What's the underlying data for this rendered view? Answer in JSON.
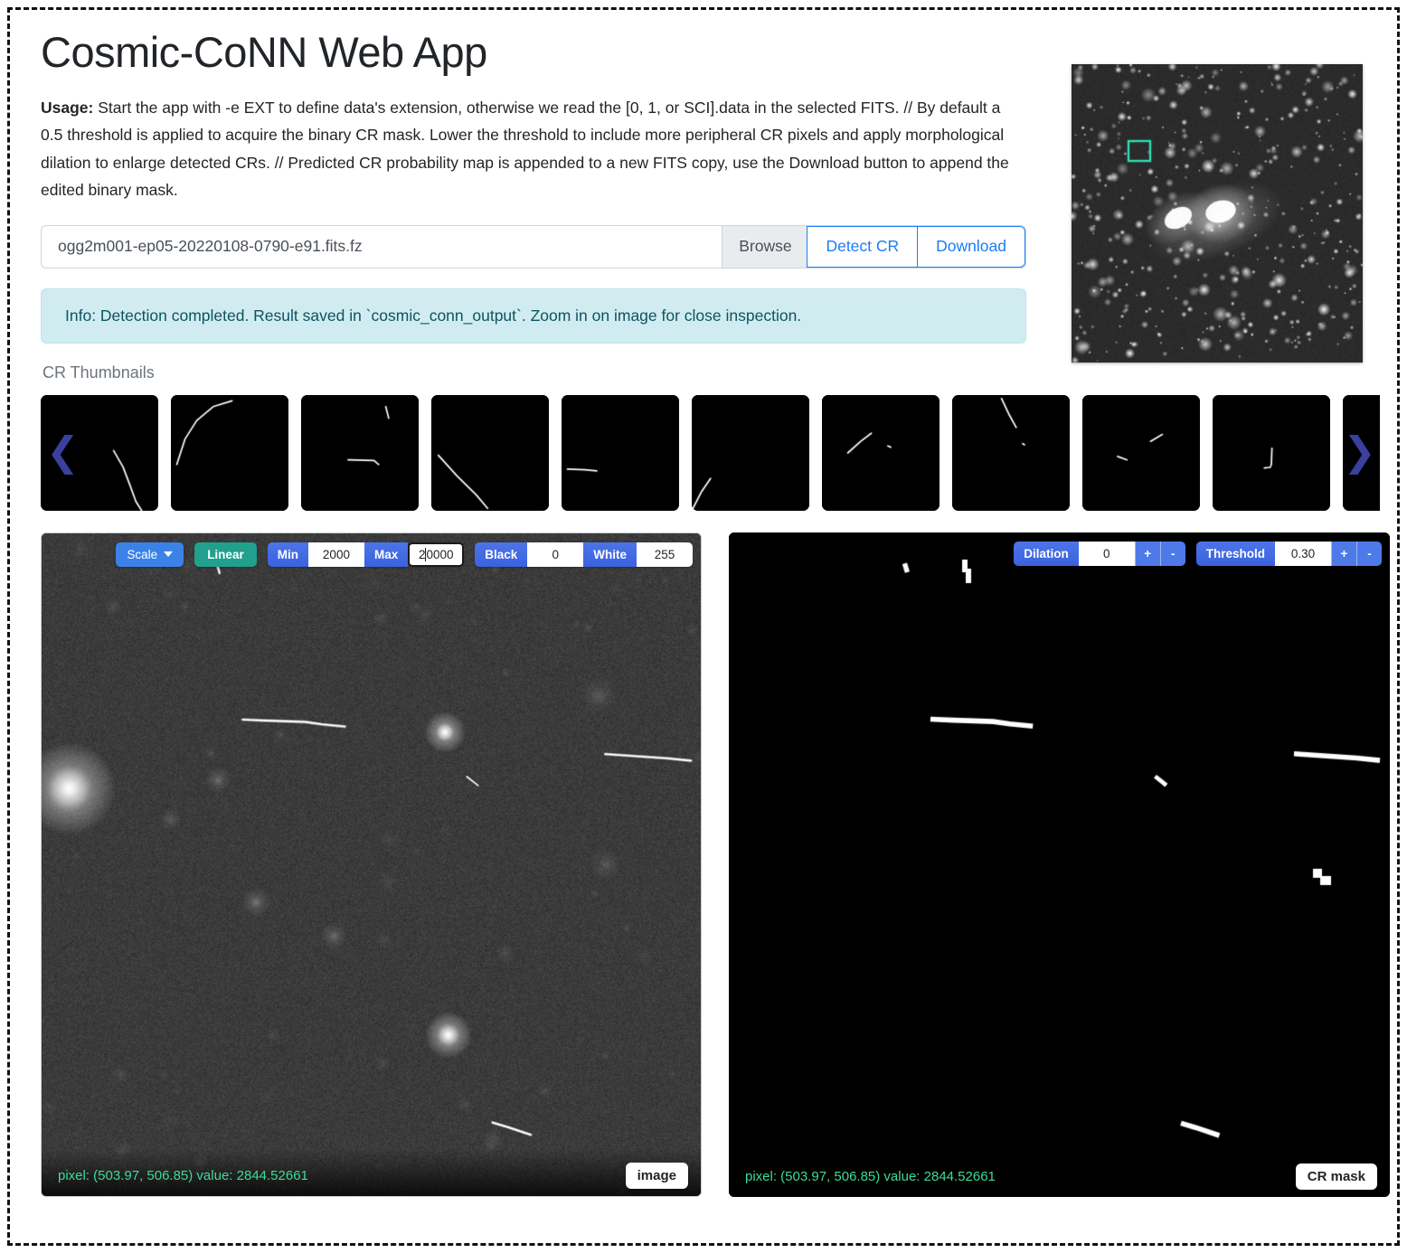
{
  "app": {
    "title": "Cosmic-CoNN Web App",
    "usage_label": "Usage:",
    "usage_text": " Start the app with -e EXT to define data's extension, otherwise we read the [0, 1, or SCI].data in the selected FITS. // By default a 0.5 threshold is applied to acquire the binary CR mask. Lower the threshold to include more peripheral CR pixels and apply morphological dilation to enlarge detected CRs. // Predicted CR probability map is appended to a new FITS copy, use the Download button to append the edited binary mask."
  },
  "file_row": {
    "filename": "ogg2m001-ep05-20220108-0790-e91.fits.fz",
    "browse_label": "Browse",
    "detect_label": "Detect CR",
    "download_label": "Download"
  },
  "alert": {
    "text": "Info: Detection completed. Result saved in `cosmic_conn_output`. Zoom in on image for close inspection."
  },
  "thumbnails": {
    "label": "CR Thumbnails",
    "prev_icon": "chevron-left-icon",
    "next_icon": "chevron-right-icon",
    "count": 11
  },
  "image_panel": {
    "scale_label": "Scale",
    "stretch_label": "Linear",
    "min_label": "Min",
    "min_value": "2000",
    "max_label": "Max",
    "max_value_head": "2",
    "max_value_tail": "0000",
    "black_label": "Black",
    "black_value": "0",
    "white_label": "White",
    "white_value": "255",
    "pixel_readout": "pixel: (503.97, 506.85) value: 2844.52661",
    "mode_label": "image"
  },
  "mask_panel": {
    "dilation_label": "Dilation",
    "dilation_value": "0",
    "threshold_label": "Threshold",
    "threshold_value": "0.30",
    "plus_label": "+",
    "minus_label": "-",
    "pixel_readout": "pixel: (503.97, 506.85) value: 2844.52661",
    "mode_label": "CR mask"
  },
  "colors": {
    "primary_blue": "#4169e1",
    "link_blue": "#1a7ef5",
    "teal": "#21a08d",
    "info_bg": "#d1ecf1",
    "info_text": "#0c5460",
    "readout_green": "#3ddb9a",
    "arrow_indigo": "#3b3f9e",
    "selection_box": "#2de0b0"
  }
}
